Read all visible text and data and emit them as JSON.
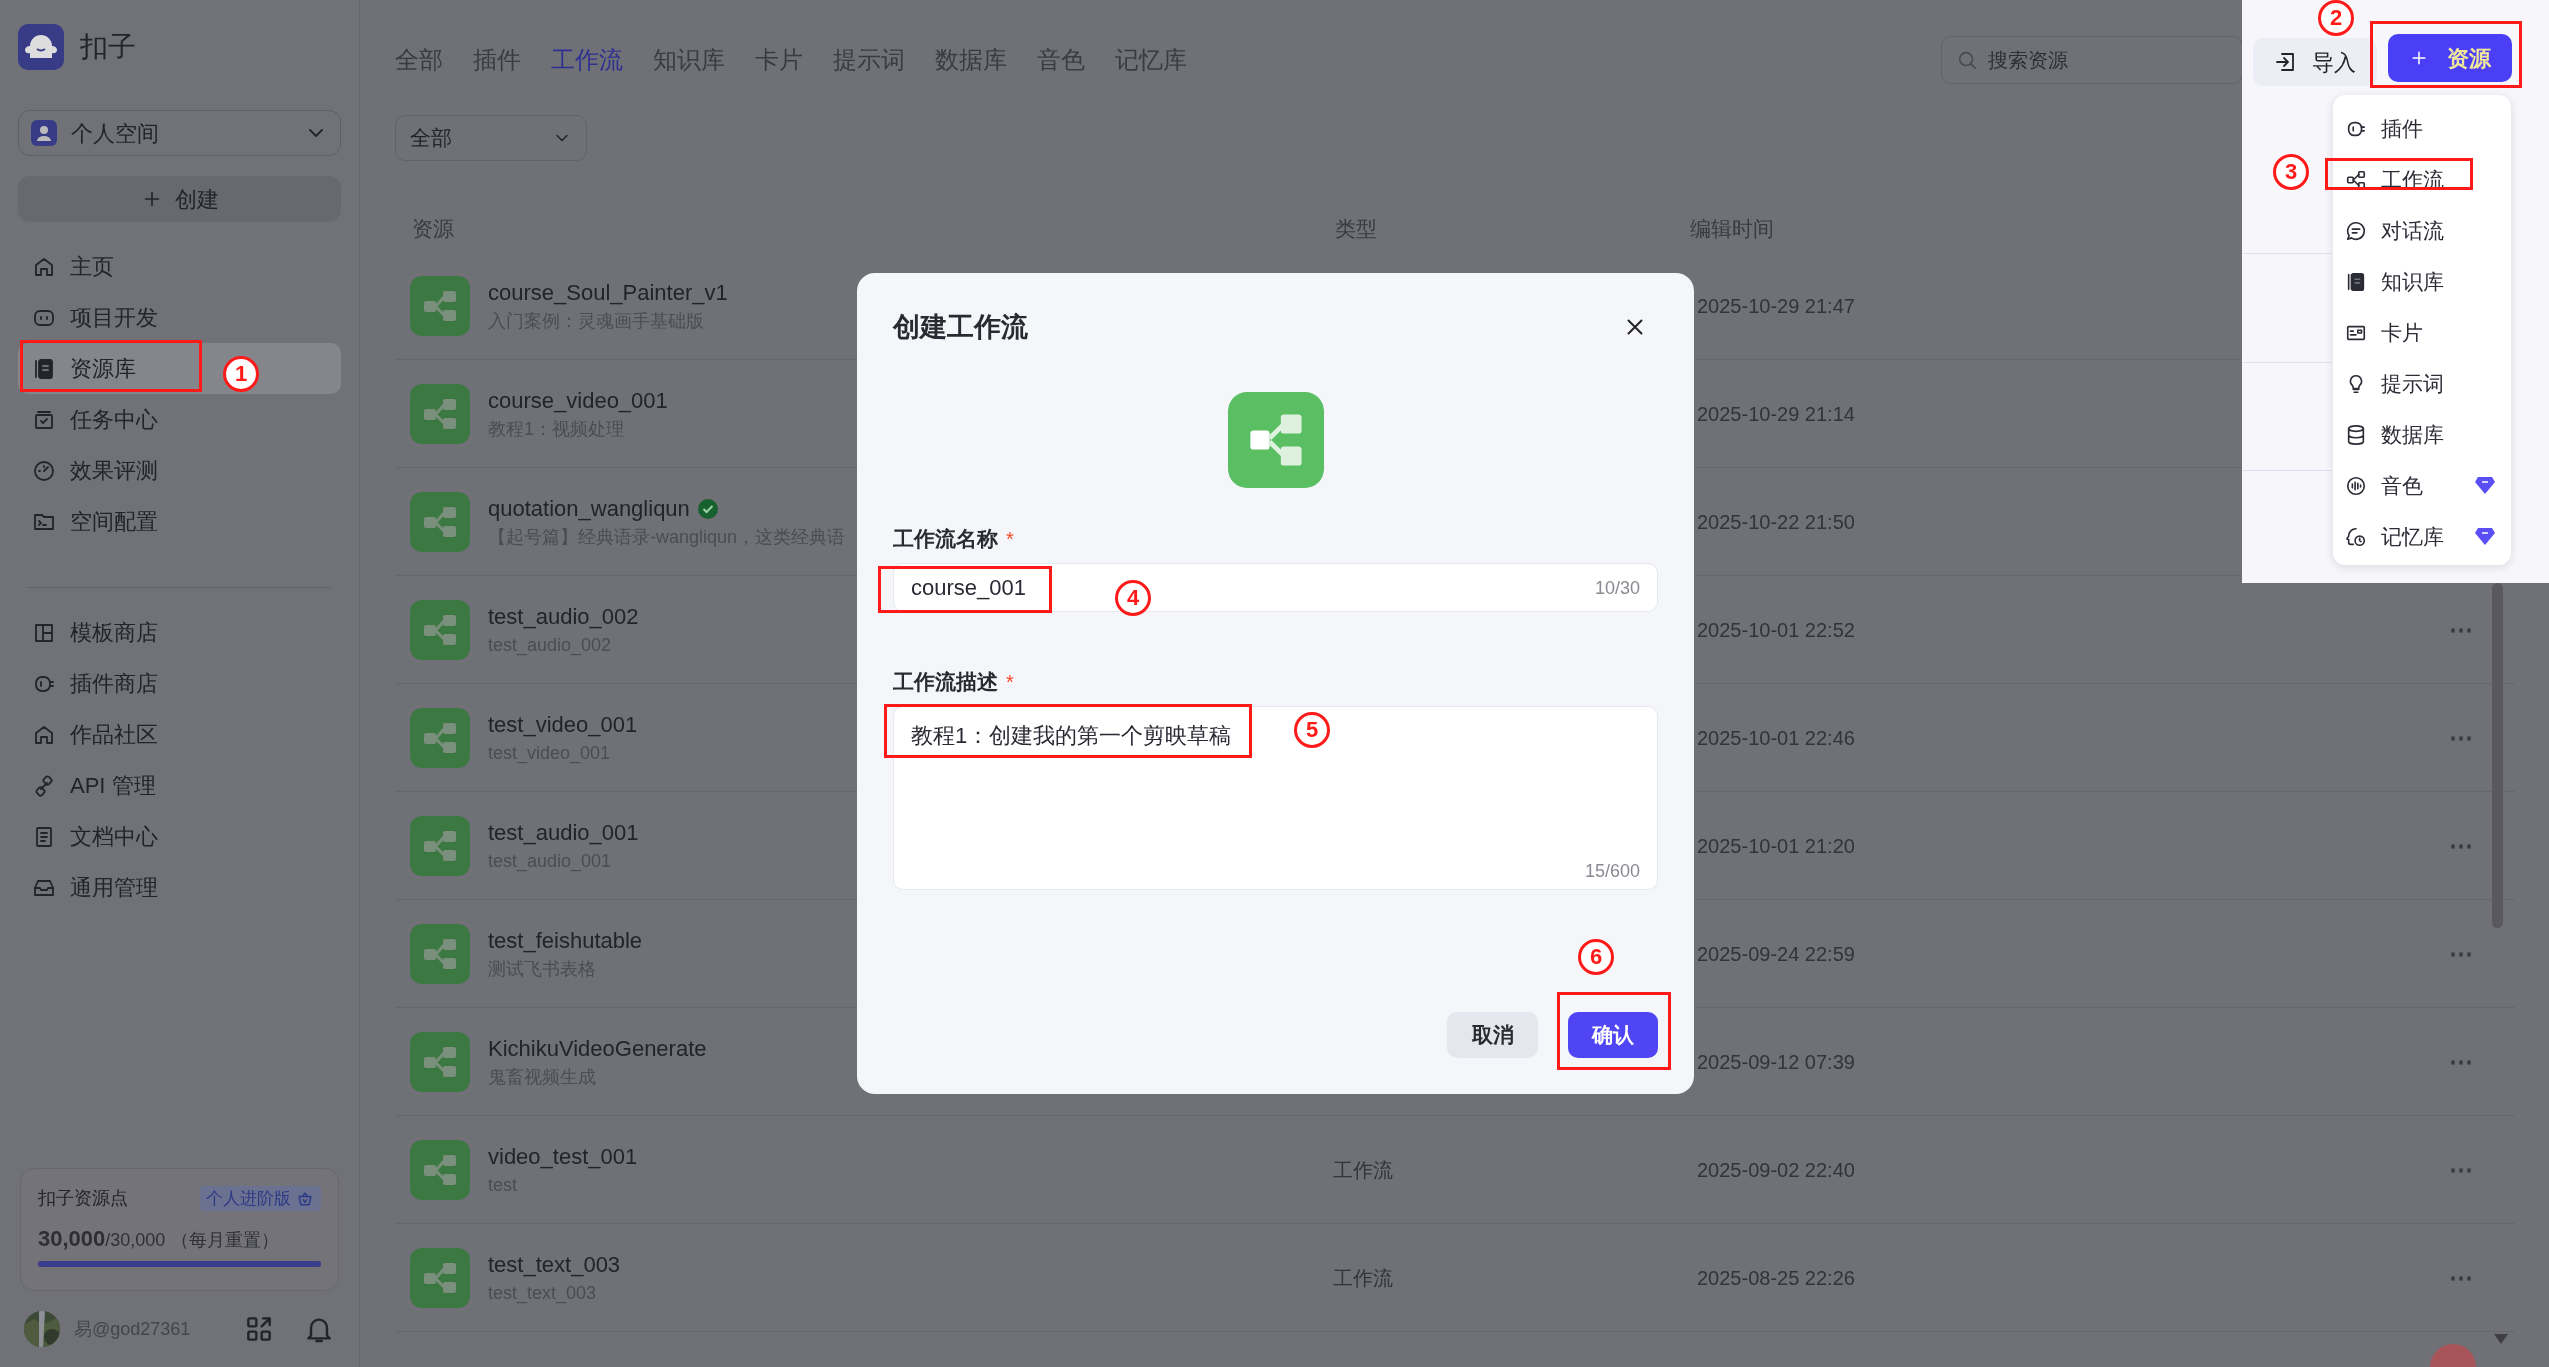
{
  "app": {
    "name": "扣子"
  },
  "sidebar": {
    "space": "个人空间",
    "create_button": "创建",
    "nav_groups": [
      [
        {
          "label": "主页",
          "selected": false
        },
        {
          "label": "项目开发",
          "selected": false
        },
        {
          "label": "资源库",
          "selected": true
        },
        {
          "label": "任务中心",
          "selected": false
        },
        {
          "label": "效果评测",
          "selected": false
        },
        {
          "label": "空间配置",
          "selected": false
        }
      ],
      [
        {
          "label": "模板商店",
          "selected": false
        },
        {
          "label": "插件商店",
          "selected": false
        },
        {
          "label": "作品社区",
          "selected": false
        },
        {
          "label": "API 管理",
          "selected": false
        },
        {
          "label": "文档中心",
          "selected": false
        },
        {
          "label": "通用管理",
          "selected": false
        }
      ]
    ],
    "points_card": {
      "title": "扣子资源点",
      "badge": "个人进阶版",
      "value": "30,000",
      "total": "/30,000",
      "note": "（每月重置）",
      "level": 1
    },
    "user": {
      "name": "易@god27361"
    }
  },
  "tabs": [
    {
      "label": "全部",
      "selected": false
    },
    {
      "label": "插件",
      "selected": false
    },
    {
      "label": "工作流",
      "selected": true
    },
    {
      "label": "知识库",
      "selected": false
    },
    {
      "label": "卡片",
      "selected": false
    },
    {
      "label": "提示词",
      "selected": false
    },
    {
      "label": "数据库",
      "selected": false
    },
    {
      "label": "音色",
      "selected": false
    },
    {
      "label": "记忆库",
      "selected": false
    }
  ],
  "search": {
    "placeholder": "搜索资源"
  },
  "filter": {
    "value": "全部"
  },
  "table": {
    "columns": [
      "资源",
      "类型",
      "编辑时间"
    ],
    "rows": [
      {
        "name": "course_Soul_Painter_v1",
        "description": "入门案例：灵魂画手基础版",
        "verified": false,
        "time": "2025-10-29 21:47"
      },
      {
        "name": "course_video_001",
        "description": "教程1：视频处理",
        "verified": false,
        "time": "2025-10-29 21:14"
      },
      {
        "name": "quotation_wangliqun",
        "description": "【起号篇】经典语录-wangliqun，这类经典语",
        "verified": true,
        "time": "2025-10-22 21:50"
      },
      {
        "name": "test_audio_002",
        "description": "test_audio_002",
        "verified": false,
        "time": "2025-10-01 22:52",
        "menu": "⋯"
      },
      {
        "name": "test_video_001",
        "description": "test_video_001",
        "verified": false,
        "time": "2025-10-01 22:46",
        "menu": "⋯"
      },
      {
        "name": "test_audio_001",
        "description": "test_audio_001",
        "verified": false,
        "time": "2025-10-01 21:20",
        "menu": "⋯"
      },
      {
        "name": "test_feishutable",
        "description": "测试飞书表格",
        "verified": false,
        "time": "2025-09-24 22:59",
        "menu": "⋯"
      },
      {
        "name": "KichikuVideoGenerate",
        "description": "鬼畜视频生成",
        "verified": false,
        "time": "2025-09-12 07:39",
        "menu": "⋯"
      },
      {
        "name": "video_test_001",
        "description": "test",
        "verified": false,
        "type": "工作流",
        "time": "2025-09-02 22:40",
        "menu": "⋯"
      },
      {
        "name": "test_text_003",
        "description": "test_text_003",
        "verified": false,
        "type": "工作流",
        "time": "2025-08-25 22:26",
        "menu": "⋯"
      }
    ]
  },
  "toolbar": {
    "import_button": "导入",
    "resource_button": "资源"
  },
  "resource_menu": [
    {
      "label": "插件",
      "premium": false
    },
    {
      "label": "工作流",
      "premium": false
    },
    {
      "label": "对话流",
      "premium": false
    },
    {
      "label": "知识库",
      "premium": false
    },
    {
      "label": "卡片",
      "premium": false
    },
    {
      "label": "提示词",
      "premium": false
    },
    {
      "label": "数据库",
      "premium": false
    },
    {
      "label": "音色",
      "premium": true
    },
    {
      "label": "记忆库",
      "premium": true
    }
  ],
  "dialog": {
    "title": "创建工作流",
    "name_label": "工作流名称",
    "name_required": "*",
    "name_value": "course_001",
    "name_counter": "10/30",
    "desc_label": "工作流描述",
    "desc_required": "*",
    "desc_value": "教程1：创建我的第一个剪映草稿",
    "desc_counter": "15/600",
    "cancel_button": "取消",
    "confirm_button": "确认"
  },
  "annotations": [
    {
      "number": "1"
    },
    {
      "number": "2"
    },
    {
      "number": "3"
    },
    {
      "number": "4"
    },
    {
      "number": "5"
    },
    {
      "number": "6"
    }
  ]
}
